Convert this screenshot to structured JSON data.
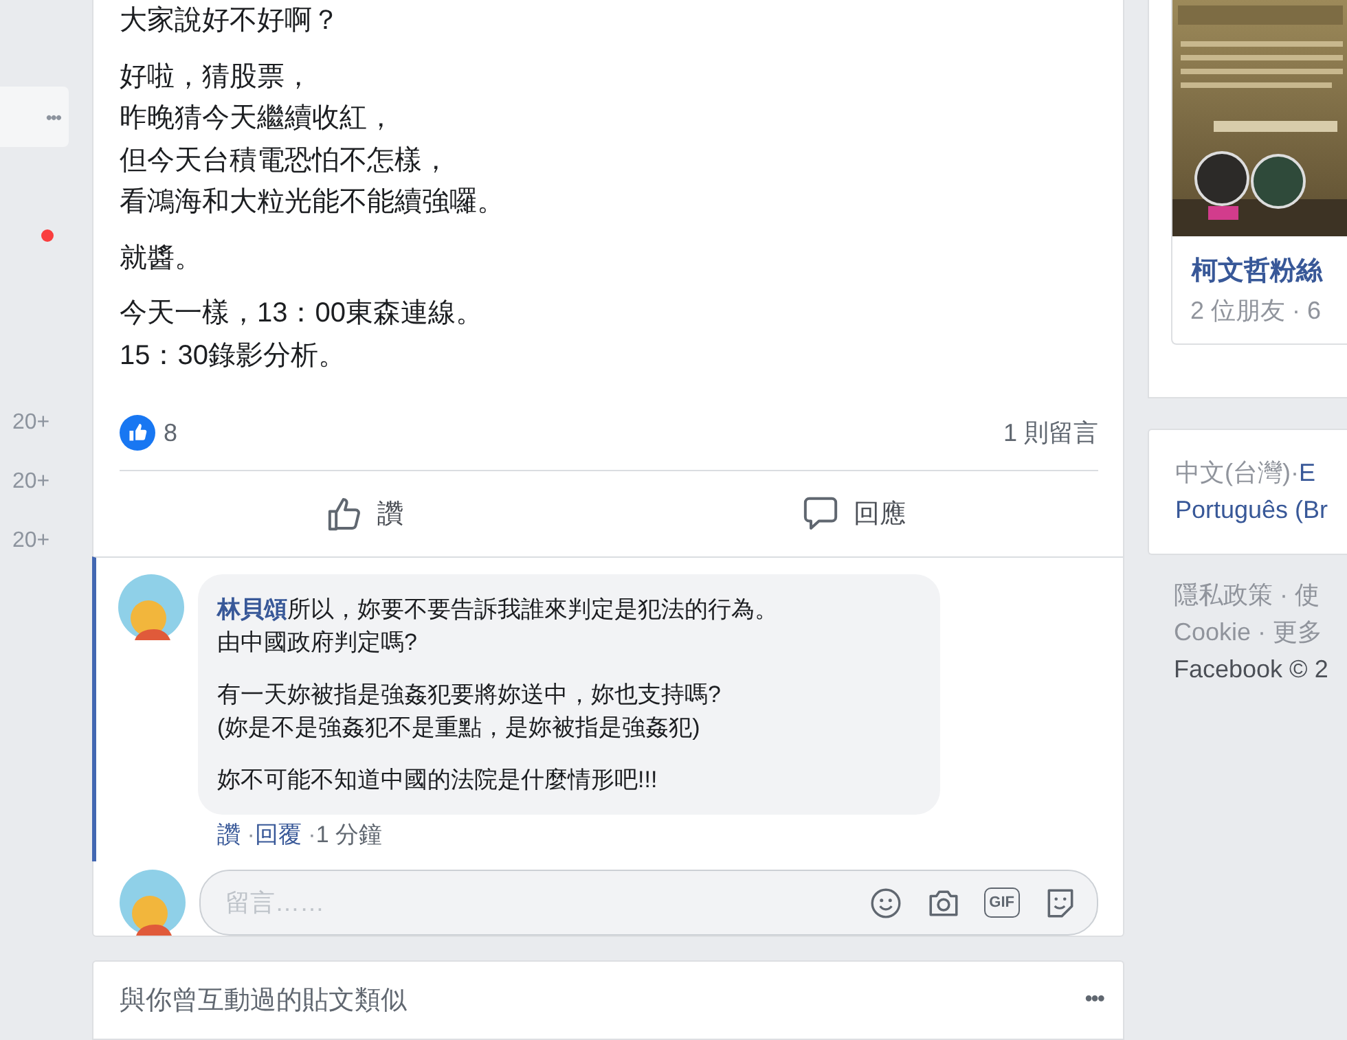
{
  "left_rail": {
    "menu": "•••",
    "notification_dot": {
      "color": "#fa3e3e"
    },
    "counts": [
      "20+",
      "20+",
      "20+"
    ]
  },
  "post": {
    "paragraphs": [
      [
        "大家說好不好啊？"
      ],
      [
        "好啦，猜股票，",
        "昨晚猜今天繼續收紅，",
        "但今天台積電恐怕不怎樣，",
        "看鴻海和大粒光能不能續強囉。"
      ],
      [
        "就醬。"
      ],
      [
        "今天一樣，13：00東森連線。",
        "15：30錄影分析。"
      ]
    ],
    "like_count": "8",
    "comment_count": "1 則留言",
    "actions": [
      {
        "kind": "like",
        "label": "讚"
      },
      {
        "kind": "comment",
        "label": "回應"
      }
    ]
  },
  "comment": {
    "author": "林貝頌",
    "paragraphs": [
      [
        "所以，妳要不要告訴我誰來判定是犯法的行為。",
        "由中國政府判定嗎?"
      ],
      [
        "有一天妳被指是強姦犯要將妳送中，妳也支持嗎?",
        "(妳是不是強姦犯不是重點，是妳被指是強姦犯)"
      ],
      [
        "妳不可能不知道中國的法院是什麼情形吧!!!"
      ]
    ],
    "actions": [
      "讚",
      "回覆"
    ],
    "separators": [
      "·",
      "·"
    ],
    "time": "1 分鐘"
  },
  "composer": {
    "placeholder": "留言……",
    "tools": [
      {
        "kind": "emoji"
      },
      {
        "kind": "camera"
      },
      {
        "kind": "gif",
        "label": "GIF"
      },
      {
        "kind": "sticker"
      }
    ]
  },
  "related": {
    "title": "與你曾互動過的貼文類似",
    "menu": "•••"
  },
  "sidebar": {
    "event": {
      "kind": "picture",
      "title": "柯文哲粉絲",
      "meta": "2 位朋友 · 6"
    },
    "language_separator": "·",
    "languages": [
      {
        "label": "中文(台灣)",
        "selected": true
      },
      {
        "label": "E",
        "selected": false
      },
      {
        "label": "Português (Br",
        "selected": false
      }
    ],
    "footer": [
      "隱私政策 · 使",
      "Cookie · 更多",
      "Facebook © 2"
    ]
  }
}
